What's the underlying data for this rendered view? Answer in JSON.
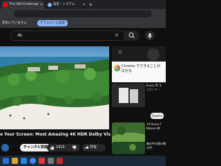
{
  "browser": {
    "tabs": [
      {
        "title": "This Will Challenge Your Sc",
        "active": true
      },
      {
        "title": "設定 - システム",
        "active": false
      }
    ],
    "new_tab": "+"
  },
  "infobar": {
    "text": "定めいていません",
    "default_button": "デフォルトに設定"
  },
  "search": {
    "query": "4k",
    "clear": "×"
  },
  "video": {
    "title": "e Your Screen: Most Amazing 4K HDR Dolby Vision",
    "channel": "...",
    "subscribe_label": "チャンネル登録",
    "likes": "1915",
    "share_label": "共有"
  },
  "ad": {
    "text": "Chrome でできることが広がる"
  },
  "suggestions": [
    {
      "title": "Every PC S",
      "meta": "スポンサー",
      "duration": ""
    },
    {
      "title": "",
      "meta": "",
      "duration": "",
      "action": "Downlo"
    },
    {
      "title": "10 Hours F Nature 4K",
      "meta": "",
      "duration": "10:00:50"
    },
    {
      "title": "森の中の鳥の鳴き声",
      "meta": "",
      "duration": ""
    }
  ],
  "colors": {
    "youtube_red": "#ff0000",
    "chrome_blue": "#8ab4f8",
    "background": "#0f0f0f"
  }
}
